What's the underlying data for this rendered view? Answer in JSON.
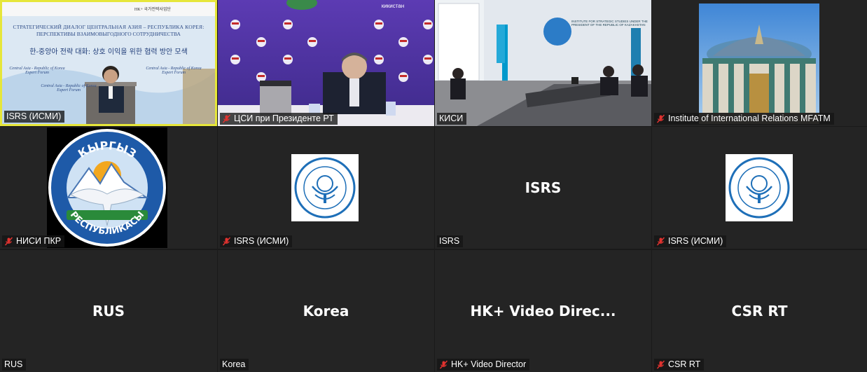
{
  "colors": {
    "background": "#1a1a1a",
    "tile": "#242424",
    "active_border": "#e6e63a",
    "mute_icon": "#e0322f"
  },
  "tiles": [
    {
      "label": "ISRS (ИСМИ)",
      "muted": false,
      "active": true,
      "video": true
    },
    {
      "label": "ЦСИ при Президенте РТ",
      "muted": true,
      "video": true
    },
    {
      "label": "КИСИ",
      "muted": false,
      "video": true
    },
    {
      "label": "Institute of International Relations MFATM",
      "muted": true,
      "video": true
    },
    {
      "label": "НИСИ ПКР",
      "muted": true,
      "avatar": "kyrgyz-emblem"
    },
    {
      "label": "ISRS (ИСМИ)",
      "muted": true,
      "avatar": "isrs-logo"
    },
    {
      "label": "ISRS",
      "muted": false,
      "center_name": "ISRS"
    },
    {
      "label": "ISRS (ИСМИ)",
      "muted": true,
      "avatar": "isrs-logo"
    },
    {
      "label": "RUS",
      "muted": false,
      "center_name": "RUS"
    },
    {
      "label": "Korea",
      "muted": false,
      "center_name": "Korea"
    },
    {
      "label": "HK+ Video Director",
      "muted": true,
      "center_name": "HK+ Video Direc..."
    },
    {
      "label": "CSR RT",
      "muted": true,
      "center_name": "CSR RT"
    }
  ],
  "banner": {
    "line1": "СТРАТЕГИЧЕСКИЙ ДИАЛОГ ЦЕНТРАЛЬНАЯ АЗИЯ – РЕСПУБЛИКА КОРЕЯ:",
    "line2": "ПЕРСПЕКТИВЫ ВЗАИМОВЫГОДНОГО СОТРУДНИЧЕСТВА",
    "line3": "한-중앙아 전략 대화: 상호 이익을 위한 협력 방안 모색",
    "forum": "Central Asia - Republic of Korea Expert Forum",
    "logo_text": "HK+ 국가전략사업단"
  },
  "kisi_wall_text": "INSTITUTE FOR STRATEGIC STUDIES UNDER THE PRESIDENT OF THE REPUBLIC OF KAZAKHSTAN",
  "tajik_banner": "кикистан",
  "kyrgyz": {
    "top": "КЫРГЫЗ",
    "bottom": "РЕСПУБЛИКАСЫ"
  }
}
